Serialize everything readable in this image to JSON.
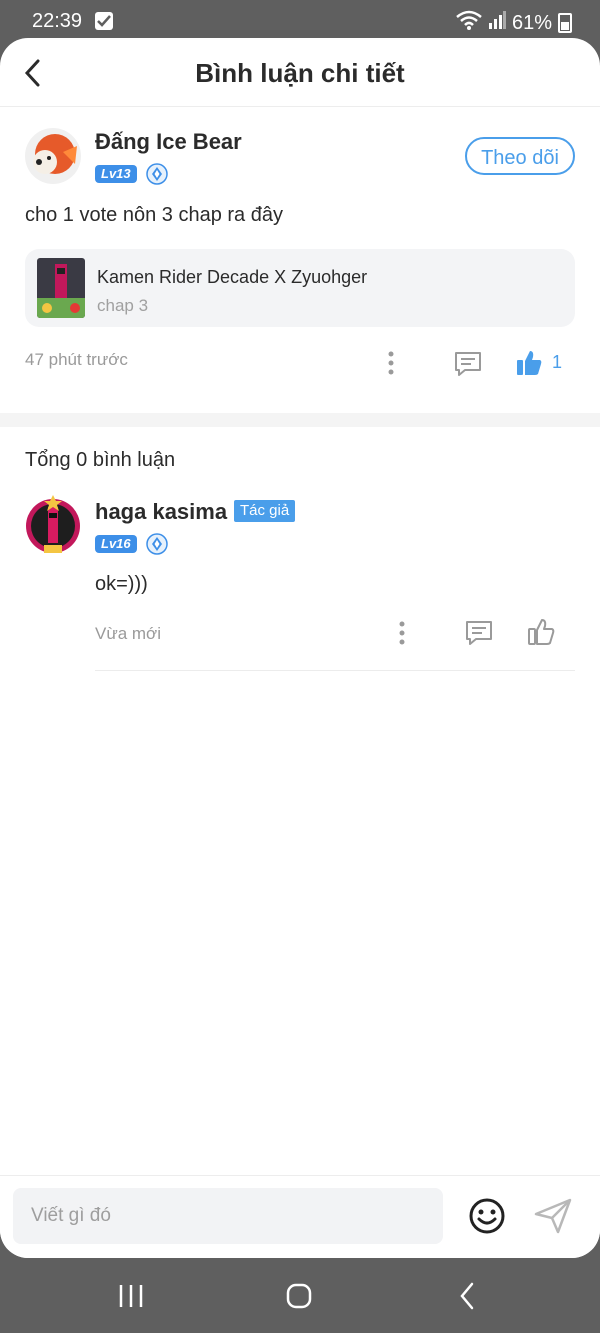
{
  "status_bar": {
    "time": "22:39",
    "battery": "61%"
  },
  "header": {
    "title": "Bình luận chi tiết"
  },
  "post": {
    "username": "Đấng Ice Bear",
    "level": "Lv13",
    "follow_label": "Theo dõi",
    "content": "cho 1 vote nôn 3 chap ra đây",
    "manga": {
      "title": "Kamen Rider Decade X Zyuohger",
      "chapter": "chap 3"
    },
    "time": "47 phút trước",
    "like_count": "1"
  },
  "comments": {
    "total_label": "Tổng 0 bình luận",
    "items": [
      {
        "username": "haga kasima",
        "badge": "Tác giả",
        "level": "Lv16",
        "content": "ok=)))",
        "time": "Vừa mới"
      }
    ]
  },
  "input": {
    "placeholder": "Viết gì đó"
  },
  "colors": {
    "accent": "#4a9eea",
    "level_badge": "#3d8fe8"
  }
}
